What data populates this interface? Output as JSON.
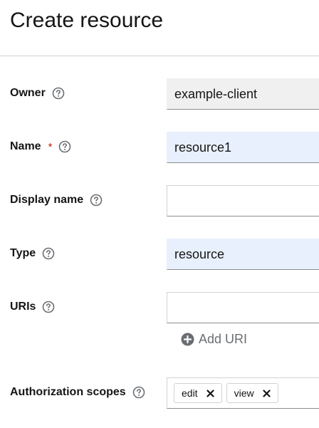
{
  "page": {
    "title": "Create resource"
  },
  "form": {
    "owner": {
      "label": "Owner",
      "value": "example-client"
    },
    "name": {
      "label": "Name",
      "required_mark": "*",
      "value": "resource1"
    },
    "display_name": {
      "label": "Display name",
      "value": ""
    },
    "type": {
      "label": "Type",
      "value": "resource"
    },
    "uris": {
      "label": "URIs",
      "value": "",
      "add_label": "Add URI"
    },
    "authorization_scopes": {
      "label": "Authorization scopes",
      "chips": [
        "edit",
        "view"
      ]
    }
  },
  "icons": {
    "help": "help-circle-icon",
    "add": "plus-circle-icon",
    "remove": "close-icon"
  },
  "colors": {
    "required": "#c9190b",
    "readonly_bg": "#f0f0f0",
    "autofill_bg": "#e8f0fe",
    "muted": "#6a6e73"
  }
}
